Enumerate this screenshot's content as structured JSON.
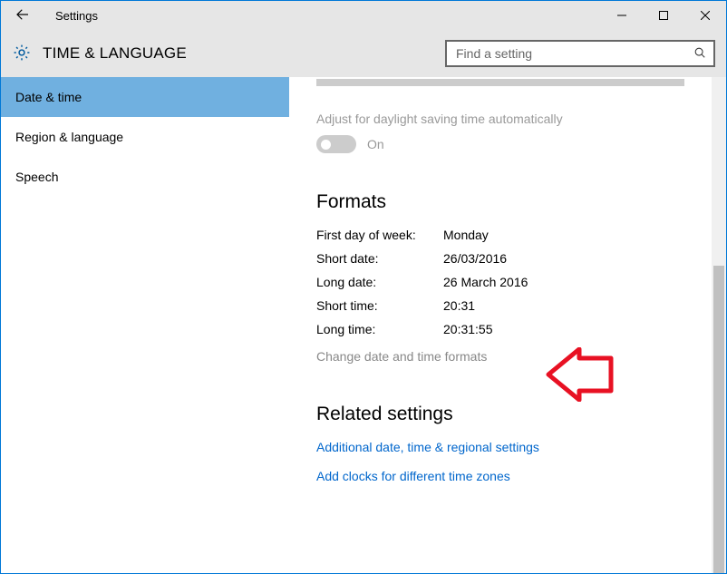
{
  "app": {
    "title": "Settings"
  },
  "page": {
    "title": "TIME & LANGUAGE"
  },
  "search": {
    "placeholder": "Find a setting"
  },
  "sidebar": {
    "items": [
      {
        "label": "Date & time",
        "selected": true
      },
      {
        "label": "Region & language",
        "selected": false
      },
      {
        "label": "Speech",
        "selected": false
      }
    ]
  },
  "content": {
    "dst": {
      "label": "Adjust for daylight saving time automatically",
      "state": "On",
      "enabled": false
    },
    "formats_heading": "Formats",
    "formats": [
      {
        "label": "First day of week:",
        "value": "Monday"
      },
      {
        "label": "Short date:",
        "value": "26/03/2016"
      },
      {
        "label": "Long date:",
        "value": "26 March 2016"
      },
      {
        "label": "Short time:",
        "value": "20:31"
      },
      {
        "label": "Long time:",
        "value": "20:31:55"
      }
    ],
    "change_formats_link": "Change date and time formats",
    "related_heading": "Related settings",
    "related_links": [
      "Additional date, time & regional settings",
      "Add clocks for different time zones"
    ]
  }
}
